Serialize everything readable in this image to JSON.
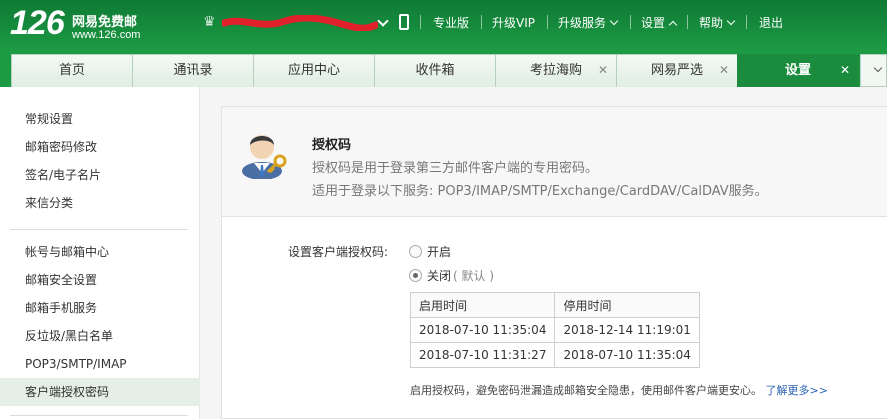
{
  "header": {
    "logo_number": "126",
    "logo_name": "网易免费邮",
    "logo_url": "www.126.com",
    "nav": [
      {
        "label": "专业版",
        "dropdown": false
      },
      {
        "label": "升级VIP",
        "dropdown": false
      },
      {
        "label": "升级服务",
        "dropdown": true
      },
      {
        "label": "设置",
        "dropdown": true,
        "expanded": true
      },
      {
        "label": "帮助",
        "dropdown": true
      },
      {
        "label": "退出",
        "dropdown": false
      }
    ],
    "colors": {
      "brand_green": "#1c9a44"
    }
  },
  "tabs": [
    {
      "label": "首页",
      "closable": false
    },
    {
      "label": "通讯录",
      "closable": false
    },
    {
      "label": "应用中心",
      "closable": false
    },
    {
      "label": "收件箱",
      "closable": false
    },
    {
      "label": "考拉海购",
      "closable": true
    },
    {
      "label": "网易严选",
      "closable": true
    },
    {
      "label": "设置",
      "closable": true,
      "active": true
    }
  ],
  "sidebar": {
    "group1": [
      "常规设置",
      "邮箱密码修改",
      "签名/电子名片",
      "来信分类"
    ],
    "group2": [
      "帐号与邮箱中心",
      "邮箱安全设置",
      "邮箱手机服务",
      "反垃圾/黑白名单",
      "POP3/SMTP/IMAP",
      "客户端授权密码"
    ],
    "active": "客户端授权密码"
  },
  "auth": {
    "title": "授权码",
    "desc": "授权码是用于登录第三方邮件客户端的专用密码。",
    "desc2": "适用于登录以下服务: POP3/IMAP/SMTP/Exchange/CardDAV/CalDAV服务。",
    "setting_label": "设置客户端授权码:",
    "option_on": "开启",
    "option_off": "关闭",
    "option_off_default": "( 默认 )",
    "selected": "关闭"
  },
  "log_table": {
    "headers": [
      "启用时间",
      "停用时间"
    ],
    "rows": [
      [
        "2018-07-10 11:35:04",
        "2018-12-14 11:19:01"
      ],
      [
        "2018-07-10 11:31:27",
        "2018-07-10 11:35:04"
      ]
    ]
  },
  "tip": {
    "text": "启用授权码，避免密码泄漏造成邮箱安全隐患，使用邮件客户端更安心。",
    "link": "了解更多>>"
  }
}
